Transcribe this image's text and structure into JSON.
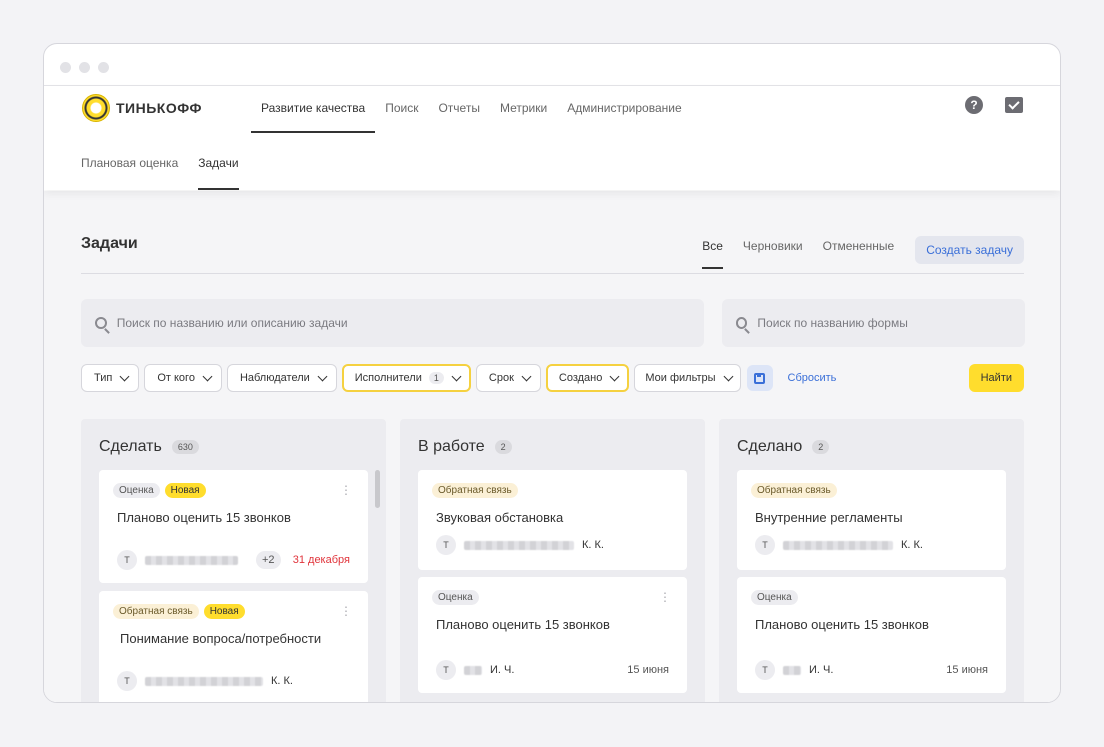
{
  "brand": {
    "name": "ТИНЬКОФФ"
  },
  "nav": {
    "items": [
      "Развитие качества",
      "Поиск",
      "Отчеты",
      "Метрики",
      "Администрирование"
    ],
    "active_index": 0,
    "icons": [
      "help-icon",
      "inbox-icon"
    ],
    "help_glyph": "?"
  },
  "subnav": {
    "items": [
      "Плановая оценка",
      "Задачи"
    ],
    "active_index": 1
  },
  "page": {
    "title": "Задачи",
    "tabs": [
      "Все",
      "Черновики",
      "Отмененные"
    ],
    "active_tab": 0,
    "create_label": "Создать задачу"
  },
  "search": {
    "task_placeholder": "Поиск по названию или описанию задачи",
    "form_placeholder": "Поиск по названию формы"
  },
  "filters": {
    "type": "Тип",
    "from": "От кого",
    "watchers": "Наблюдатели",
    "assignees": "Исполнители",
    "assignees_count": "1",
    "deadline": "Срок",
    "created": "Создано",
    "my_filters": "Мои фильтры",
    "reset": "Сбросить",
    "find": "Найти"
  },
  "colors": {
    "accent": "#ffdd2d",
    "link": "#3a6fd8",
    "danger": "#e0343b"
  },
  "columns": [
    {
      "title": "Сделать",
      "count": "630",
      "cards": [
        {
          "tags": [
            {
              "text": "Оценка",
              "kind": "default"
            },
            {
              "text": "Новая",
              "kind": "new"
            }
          ],
          "title": "Планово оценить 15 звонков",
          "avatar": "Т",
          "initials": "",
          "extra": "+2",
          "due": "31 декабря",
          "date": ""
        },
        {
          "tags": [
            {
              "text": "Обратная связь",
              "kind": "feedback"
            },
            {
              "text": "Новая",
              "kind": "new"
            }
          ],
          "title": "Понимание вопроса/потребности",
          "avatar": "Т",
          "initials": "К. К.",
          "extra": "",
          "due": "",
          "date": ""
        }
      ]
    },
    {
      "title": "В работе",
      "count": "2",
      "cards": [
        {
          "tags": [
            {
              "text": "Обратная связь",
              "kind": "feedback"
            }
          ],
          "title": "Звуковая обстановка",
          "avatar": "Т",
          "initials": "К. К.",
          "extra": "",
          "due": "",
          "date": ""
        },
        {
          "tags": [
            {
              "text": "Оценка",
              "kind": "default"
            }
          ],
          "title": "Планово оценить 15 звонков",
          "avatar": "Т",
          "initials": "И. Ч.",
          "extra": "",
          "due": "",
          "date": "15 июня"
        }
      ]
    },
    {
      "title": "Сделано",
      "count": "2",
      "cards": [
        {
          "tags": [
            {
              "text": "Обратная связь",
              "kind": "feedback"
            }
          ],
          "title": "Внутренние регламенты",
          "avatar": "Т",
          "initials": "К. К.",
          "extra": "",
          "due": "",
          "date": ""
        },
        {
          "tags": [
            {
              "text": "Оценка",
              "kind": "default"
            }
          ],
          "title": "Планово оценить 15 звонков",
          "avatar": "Т",
          "initials": "И. Ч.",
          "extra": "",
          "due": "",
          "date": "15 июня"
        }
      ]
    }
  ]
}
